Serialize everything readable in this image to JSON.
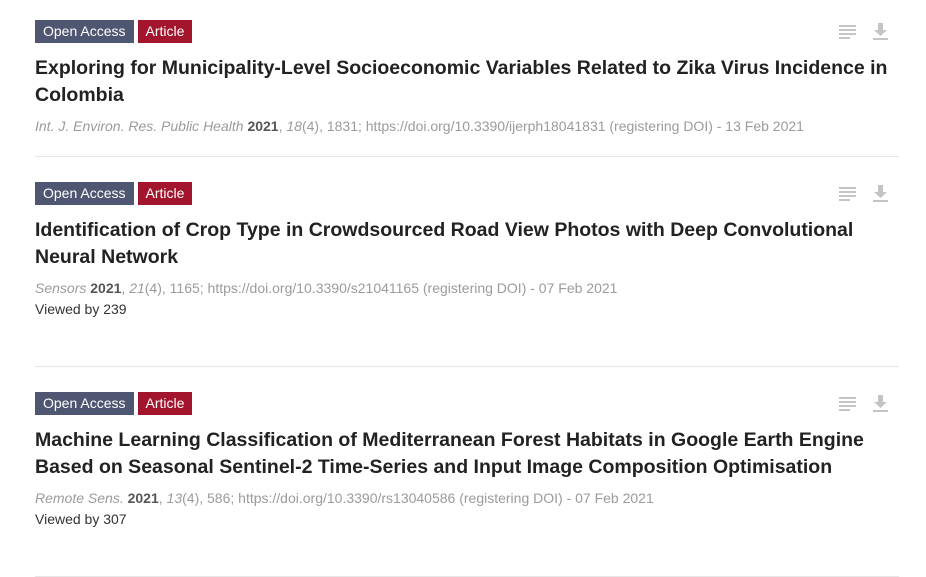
{
  "articles": [
    {
      "badge_access": "Open Access",
      "badge_type": "Article",
      "title": "Exploring for Municipality-Level Socioeconomic Variables Related to Zika Virus Incidence in Colombia",
      "journal": "Int. J. Environ. Res. Public Health",
      "year": "2021",
      "volume": "18",
      "rest": "(4), 1831; https://doi.org/10.3390/ijerph18041831 (registering DOI) - 13 Feb 2021",
      "viewed": ""
    },
    {
      "badge_access": "Open Access",
      "badge_type": "Article",
      "title": "Identification of Crop Type in Crowdsourced Road View Photos with Deep Convolutional Neural Network",
      "journal": "Sensors",
      "year": "2021",
      "volume": "21",
      "rest": "(4), 1165; https://doi.org/10.3390/s21041165 (registering DOI) - 07 Feb 2021",
      "viewed": "Viewed by 239"
    },
    {
      "badge_access": "Open Access",
      "badge_type": "Article",
      "title": "Machine Learning Classification of Mediterranean Forest Habitats in Google Earth Engine Based on Seasonal Sentinel-2 Time-Series and Input Image Composition Optimisation",
      "journal": "Remote Sens.",
      "year": "2021",
      "volume": "13",
      "rest": "(4), 586; https://doi.org/10.3390/rs13040586 (registering DOI) - 07 Feb 2021",
      "viewed": "Viewed by 307"
    }
  ],
  "icons": {
    "abstract": "lines-icon",
    "download": "download-icon",
    "color": "#c4c4c4"
  }
}
